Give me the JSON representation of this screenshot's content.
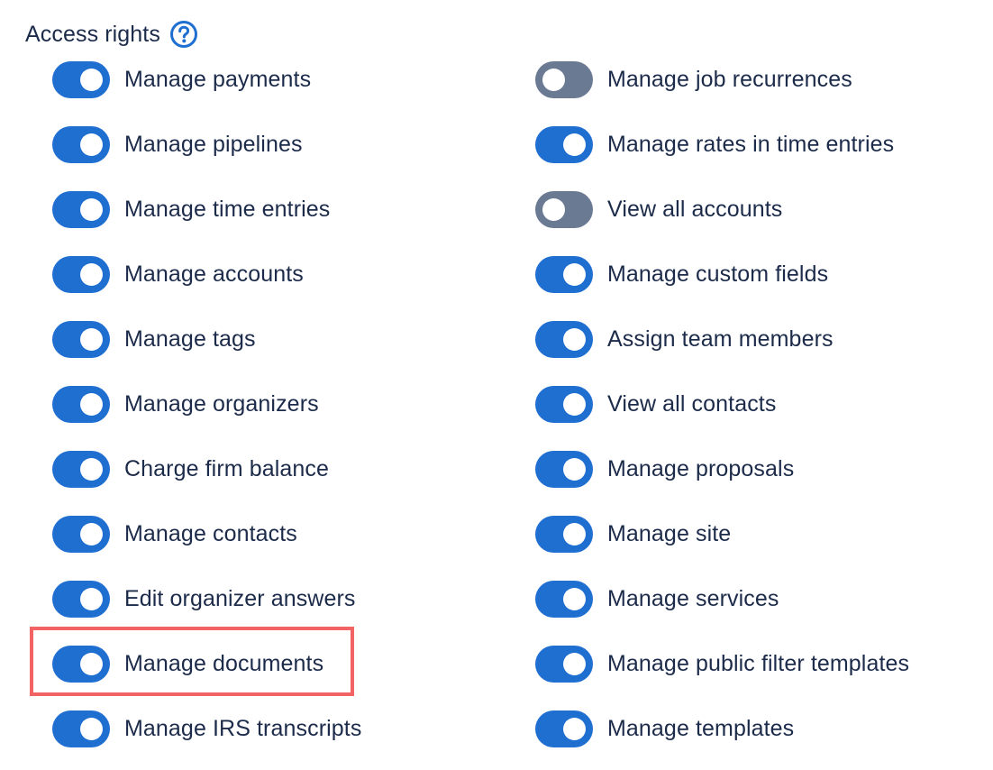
{
  "header": {
    "title": "Access rights",
    "help_icon": "question-circle-icon"
  },
  "colors": {
    "toggle_on": "#1f6fd1",
    "toggle_off": "#6b7a93",
    "text": "#1c2b4a",
    "highlight": "#f26464"
  },
  "permissions_left": [
    {
      "label": "Manage payments",
      "enabled": true
    },
    {
      "label": "Manage pipelines",
      "enabled": true
    },
    {
      "label": "Manage time entries",
      "enabled": true
    },
    {
      "label": "Manage accounts",
      "enabled": true
    },
    {
      "label": "Manage tags",
      "enabled": true
    },
    {
      "label": "Manage organizers",
      "enabled": true
    },
    {
      "label": "Charge firm balance",
      "enabled": true
    },
    {
      "label": "Manage contacts",
      "enabled": true
    },
    {
      "label": "Edit organizer answers",
      "enabled": true
    },
    {
      "label": "Manage documents",
      "enabled": true,
      "highlighted": true
    },
    {
      "label": "Manage IRS transcripts",
      "enabled": true
    }
  ],
  "permissions_right": [
    {
      "label": "Manage job recurrences",
      "enabled": false
    },
    {
      "label": "Manage rates in time entries",
      "enabled": true
    },
    {
      "label": "View all accounts",
      "enabled": false
    },
    {
      "label": "Manage custom fields",
      "enabled": true
    },
    {
      "label": "Assign team members",
      "enabled": true
    },
    {
      "label": "View all contacts",
      "enabled": true
    },
    {
      "label": "Manage proposals",
      "enabled": true
    },
    {
      "label": "Manage site",
      "enabled": true
    },
    {
      "label": "Manage services",
      "enabled": true
    },
    {
      "label": "Manage public filter templates",
      "enabled": true
    },
    {
      "label": "Manage templates",
      "enabled": true
    }
  ]
}
